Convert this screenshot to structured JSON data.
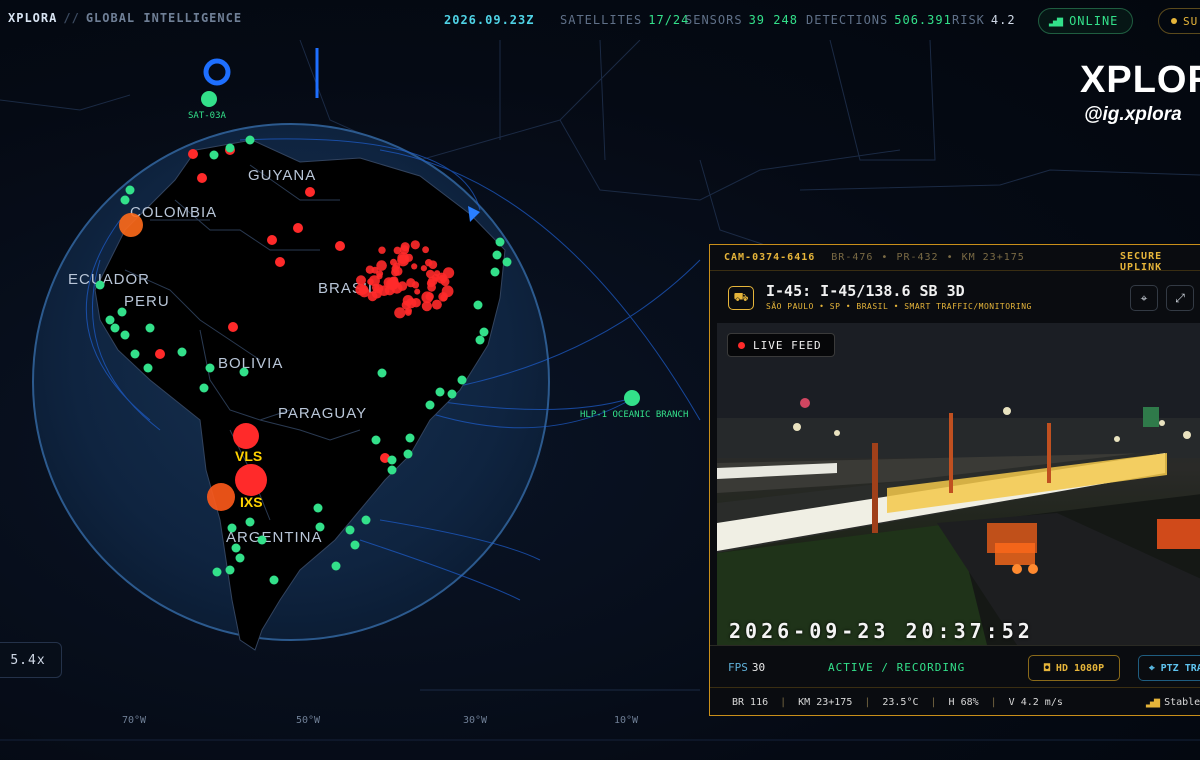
{
  "header": {
    "brand": "XPLORA",
    "subtitle": "GLOBAL INTELLIGENCE",
    "date": "2026.09.23Z",
    "stats": [
      {
        "key": "SATELLITES",
        "value": "17/24"
      },
      {
        "key": "SENSORS",
        "value": "39 248"
      },
      {
        "key": "DETECTIONS",
        "value": "506.391"
      },
      {
        "key": "RISK",
        "value": "4.2"
      }
    ],
    "status": "ONLINE",
    "status_icon": "signal-bars-icon",
    "sub_pill": "SU"
  },
  "map": {
    "countries": [
      {
        "name": "GUYANA"
      },
      {
        "name": "COLOMBIA"
      },
      {
        "name": "ECUADOR"
      },
      {
        "name": "PERU"
      },
      {
        "name": "BRASIL"
      },
      {
        "name": "BOLIVIA"
      },
      {
        "name": "PARAGUAY"
      },
      {
        "name": "ARGENTINA"
      }
    ],
    "nodes": [
      {
        "name": "SAT-03A"
      },
      {
        "name": "HLP-1 OCEANIC BRANCH"
      }
    ],
    "alerts": [
      "VLS",
      "IXS"
    ],
    "longitudes": [
      "70°W",
      "50°W",
      "30°W",
      "10°W"
    ],
    "zoom": "5.4x",
    "colors": {
      "sensor": "#33e08a",
      "detection": "#ff2a2a",
      "alert": "#ff5a1a",
      "cable": "#1e5fd0"
    }
  },
  "watermark": {
    "logo": "XPLORA",
    "handle": "@ig.xplora"
  },
  "camera": {
    "id": "CAM-0374-6416",
    "road_codes": [
      "BR-476",
      "PR-432",
      "KM 23+175"
    ],
    "secure": "SECURE UPLINK",
    "title": "I-45: I-45/138.6 SB 3D",
    "location": "SÃO PAULO • SP • BRASIL • SMART TRAFFIC/MONITORING",
    "live": "LIVE FEED",
    "timestamp": "2026-09-23 20:37:52",
    "fps_label": "FPS",
    "fps_value": "30",
    "recording": "ACTIVE / RECORDING",
    "quality": "HD 1080P",
    "ptz": "PTZ TRACK",
    "footer": [
      "BR 116",
      "KM 23+175",
      "23.5°C",
      "H 68%",
      "V 4.2 m/s"
    ],
    "signal": "Stable"
  }
}
